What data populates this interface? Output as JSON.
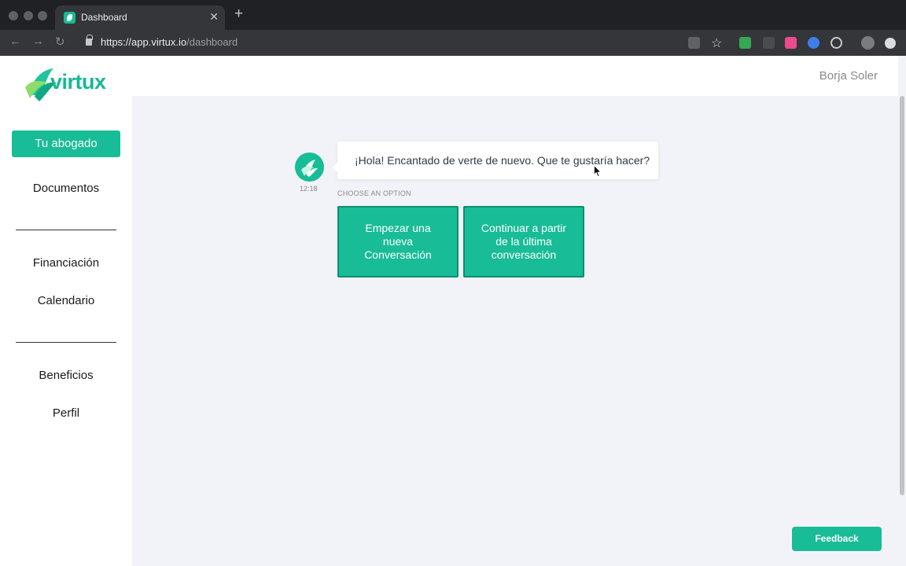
{
  "browser": {
    "tab_title": "Dashboard",
    "url_host": "https://app.virtux.io",
    "url_path": "/dashboard",
    "icons": [
      "back-icon",
      "forward-icon",
      "reload-icon",
      "lock-icon",
      "translate-icon",
      "star-icon"
    ]
  },
  "brand": {
    "name": "virtux",
    "color": "#18bc96"
  },
  "sidebar": {
    "primary_button": "Tu abogado",
    "items": [
      "Documentos",
      "Financiación",
      "Calendario",
      "Beneficios",
      "Perfil"
    ]
  },
  "header": {
    "user_name": "Borja Soler"
  },
  "chat": {
    "message": "¡Hola! Encantado de verte de nuevo. Que te gustaría hacer?",
    "time": "12:18",
    "choose_label": "CHOOSE AN OPTION",
    "options": [
      "Empezar una nueva Conversación",
      "Continuar a partir de la última conversación"
    ]
  },
  "feedback_label": "Feedback"
}
